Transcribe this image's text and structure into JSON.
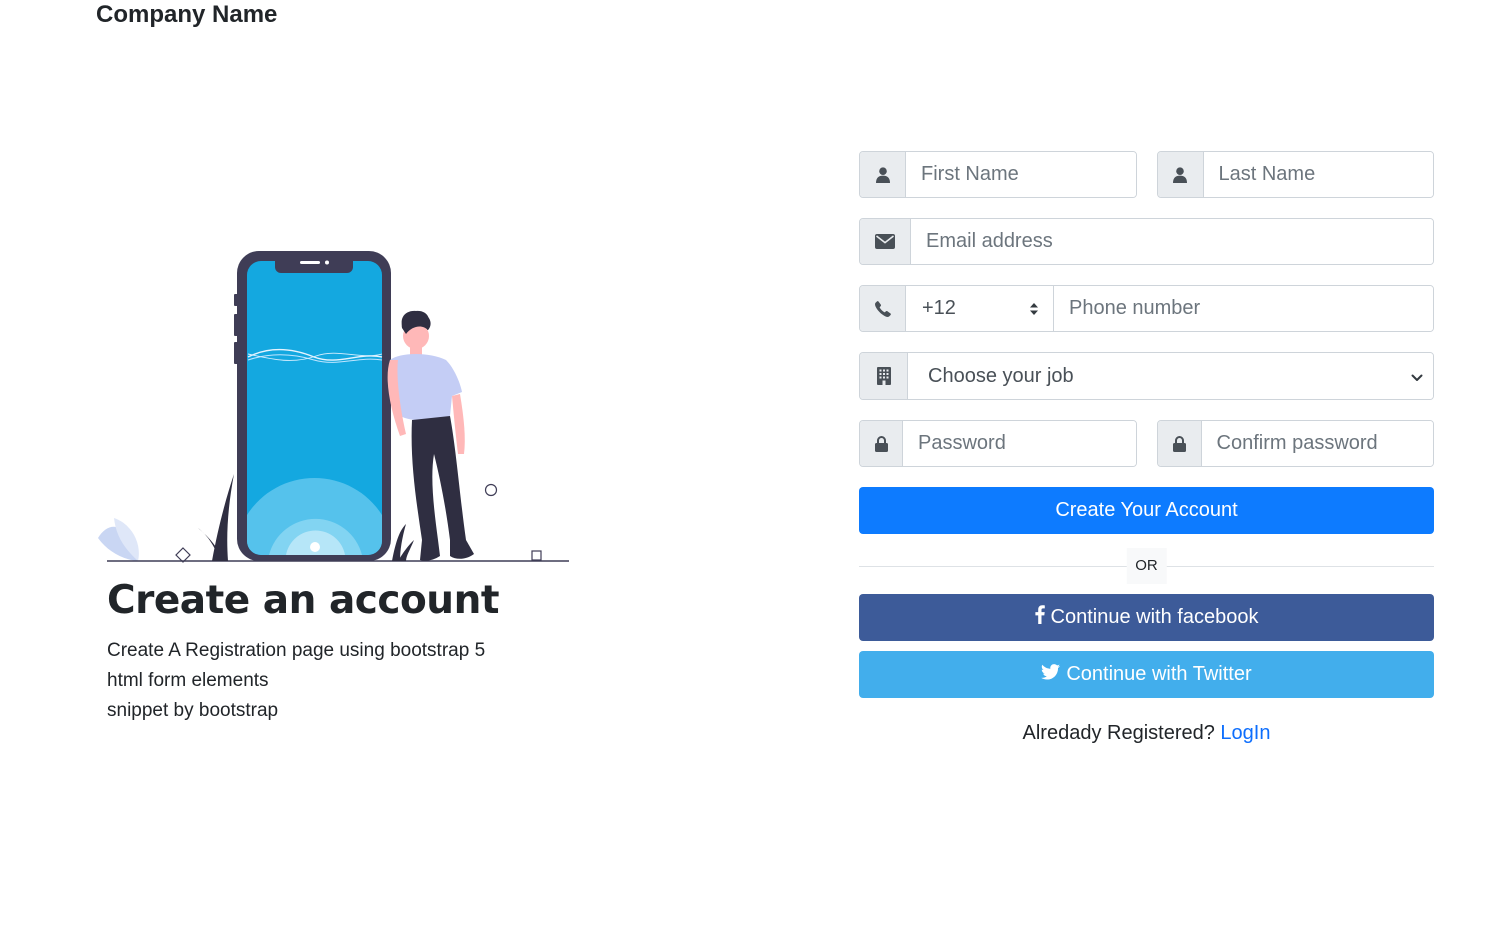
{
  "brand": {
    "name": "Company Name"
  },
  "hero": {
    "title": "Create an account",
    "lines": [
      "Create A Registration page using bootstrap 5",
      "html form elements",
      "snippet by bootstrap"
    ]
  },
  "form": {
    "first_name": {
      "placeholder": "First Name",
      "icon": "user-icon"
    },
    "last_name": {
      "placeholder": "Last Name",
      "icon": "user-icon"
    },
    "email": {
      "placeholder": "Email address",
      "icon": "envelope-icon"
    },
    "phone": {
      "code": "+12",
      "placeholder": "Phone number",
      "icon": "phone-icon"
    },
    "job": {
      "selected": "Choose your job",
      "icon": "building-icon"
    },
    "password": {
      "placeholder": "Password",
      "icon": "lock-icon"
    },
    "confirm_password": {
      "placeholder": "Confirm password",
      "icon": "lock-icon"
    },
    "submit_label": "Create Your Account",
    "or_label": "OR",
    "facebook_label": "Continue with facebook",
    "twitter_label": "Continue with Twitter",
    "login_prompt": "Alredady Registered?",
    "login_link": "LogIn"
  },
  "colors": {
    "primary": "#0d7bff",
    "facebook": "#3d5b99",
    "twitter": "#42aeec",
    "link": "#0d6efd"
  }
}
